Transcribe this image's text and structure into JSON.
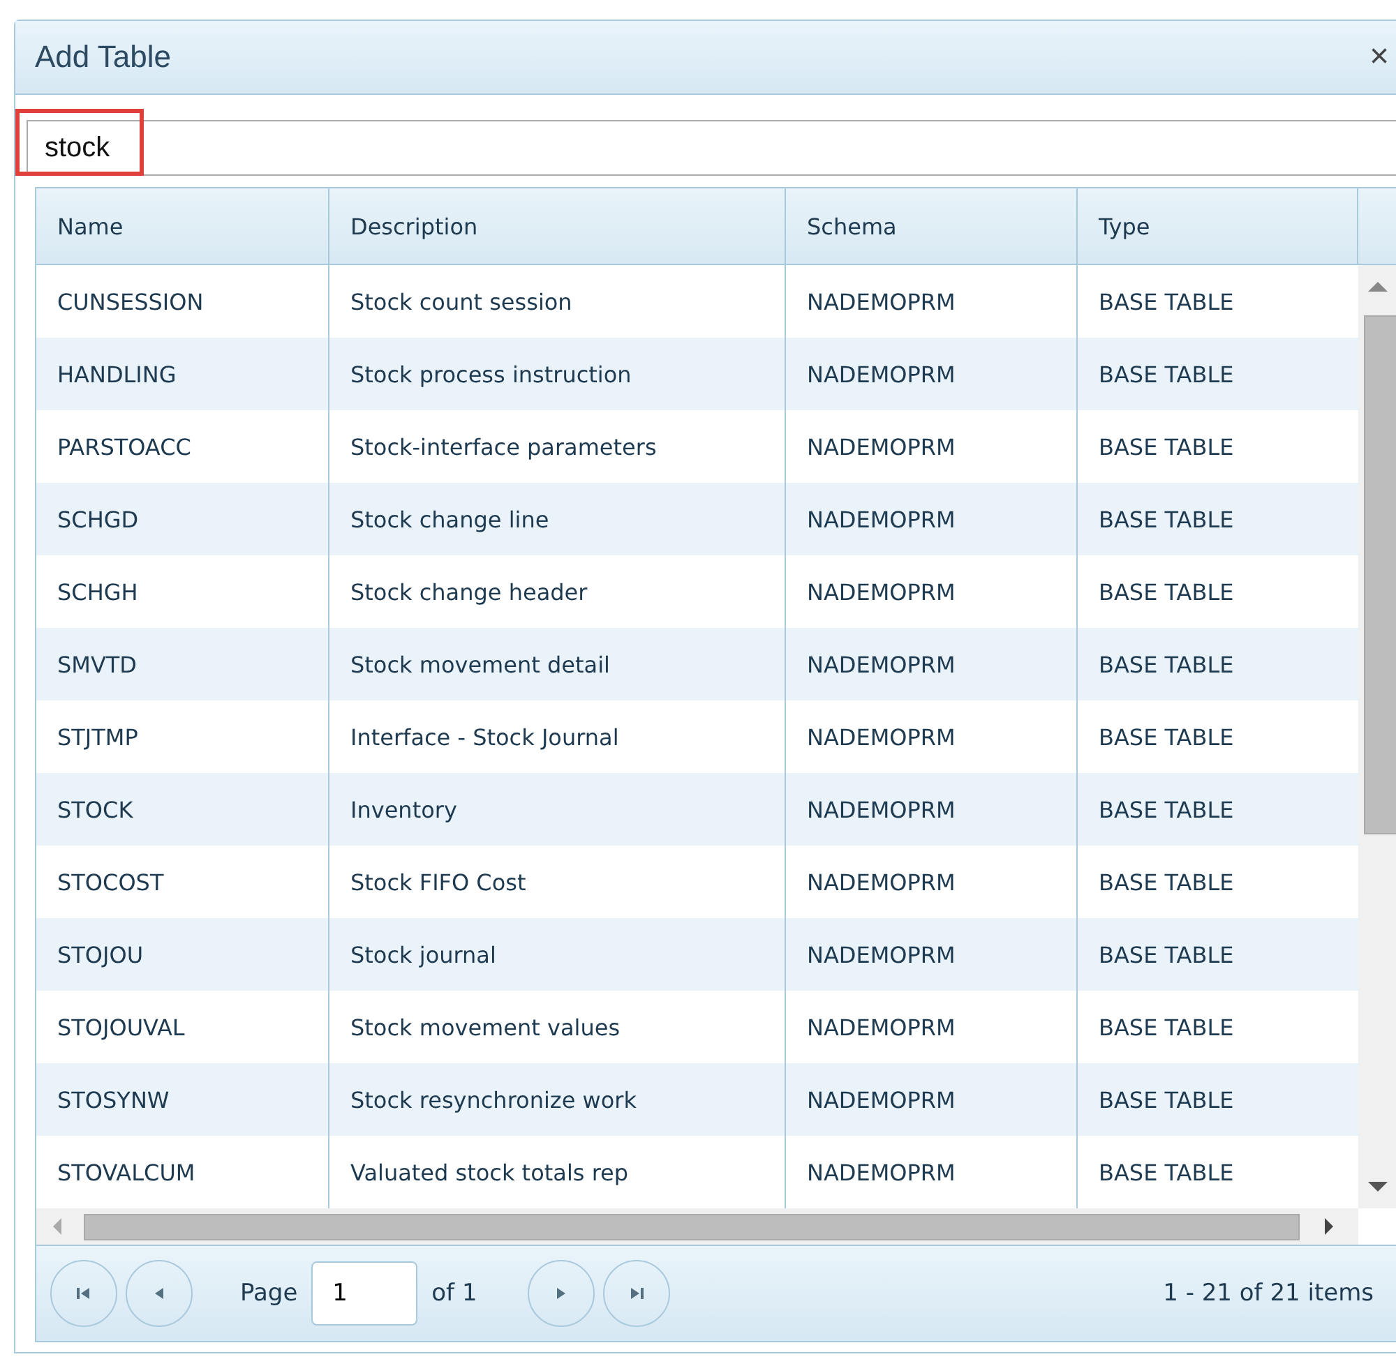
{
  "window": {
    "title": "Add Table",
    "close": "×"
  },
  "search": {
    "value": "stock",
    "highlighted": true
  },
  "table": {
    "columns": [
      "Name",
      "Description",
      "Schema",
      "Type"
    ],
    "rows": [
      {
        "name": "CUNSESSION",
        "description": "Stock count session",
        "schema": "NADEMOPRM",
        "type": "BASE TABLE"
      },
      {
        "name": "HANDLING",
        "description": "Stock process instruction",
        "schema": "NADEMOPRM",
        "type": "BASE TABLE"
      },
      {
        "name": "PARSTOACC",
        "description": "Stock-interface parameters",
        "schema": "NADEMOPRM",
        "type": "BASE TABLE"
      },
      {
        "name": "SCHGD",
        "description": "Stock change line",
        "schema": "NADEMOPRM",
        "type": "BASE TABLE"
      },
      {
        "name": "SCHGH",
        "description": "Stock change header",
        "schema": "NADEMOPRM",
        "type": "BASE TABLE"
      },
      {
        "name": "SMVTD",
        "description": "Stock movement detail",
        "schema": "NADEMOPRM",
        "type": "BASE TABLE"
      },
      {
        "name": "STJTMP",
        "description": "Interface - Stock Journal",
        "schema": "NADEMOPRM",
        "type": "BASE TABLE"
      },
      {
        "name": "STOCK",
        "description": "Inventory",
        "schema": "NADEMOPRM",
        "type": "BASE TABLE"
      },
      {
        "name": "STOCOST",
        "description": "Stock FIFO Cost",
        "schema": "NADEMOPRM",
        "type": "BASE TABLE"
      },
      {
        "name": "STOJOU",
        "description": "Stock journal",
        "schema": "NADEMOPRM",
        "type": "BASE TABLE"
      },
      {
        "name": "STOJOUVAL",
        "description": "Stock movement values",
        "schema": "NADEMOPRM",
        "type": "BASE TABLE"
      },
      {
        "name": "STOSYNW",
        "description": "Stock resynchronize work",
        "schema": "NADEMOPRM",
        "type": "BASE TABLE"
      },
      {
        "name": "STOVALCUM",
        "description": "Valuated stock totals rep",
        "schema": "NADEMOPRM",
        "type": "BASE TABLE"
      }
    ]
  },
  "pager": {
    "page_label": "Page",
    "page": "1",
    "of_label": "of 1",
    "summary": "1 - 21 of 21 items"
  }
}
